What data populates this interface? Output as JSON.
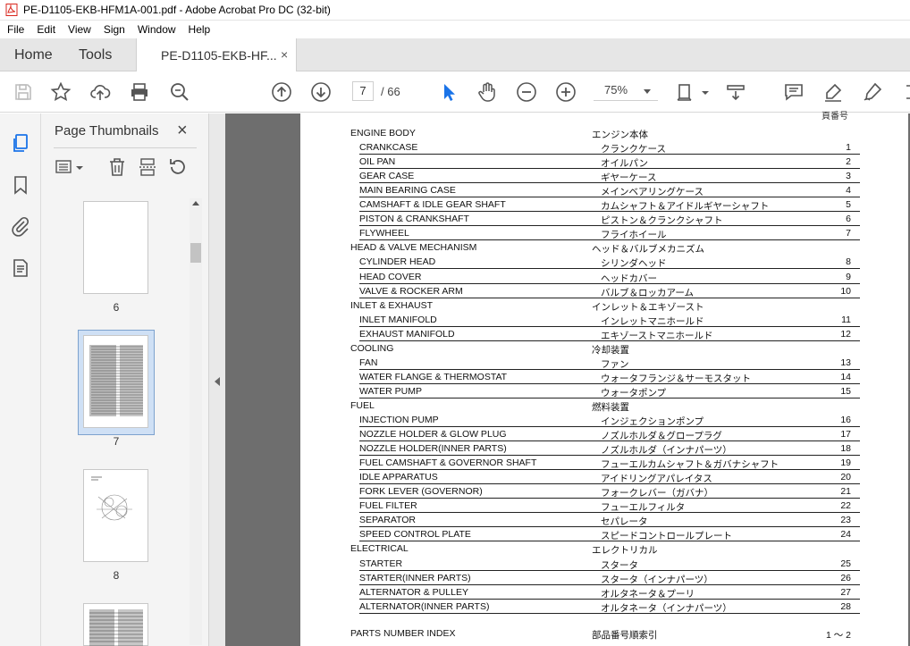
{
  "window": {
    "title": "PE-D1105-EKB-HFM1A-001.pdf - Adobe Acrobat Pro DC (32-bit)"
  },
  "menu": [
    "File",
    "Edit",
    "View",
    "Sign",
    "Window",
    "Help"
  ],
  "tabs": {
    "home": "Home",
    "tools": "Tools",
    "document": "PE-D1105-EKB-HF...",
    "close": "×"
  },
  "toolbar": {
    "page_current": "7",
    "page_total": "/ 66",
    "zoom": "75%"
  },
  "thumbnails": {
    "title": "Page Thumbnails",
    "close": "×",
    "pages": [
      "6",
      "7",
      "8"
    ]
  },
  "document": {
    "top_mark": "頁番号",
    "sections": [
      {
        "en": "ENGINE BODY",
        "jp": "エンジン本体",
        "items": [
          {
            "en": "CRANKCASE",
            "jp": "クランクケース",
            "page": "1"
          },
          {
            "en": "OIL PAN",
            "jp": "オイルパン",
            "page": "2"
          },
          {
            "en": "GEAR CASE",
            "jp": "ギヤーケース",
            "page": "3"
          },
          {
            "en": "MAIN BEARING CASE",
            "jp": "メインベアリングケース",
            "page": "4"
          },
          {
            "en": "CAMSHAFT & IDLE GEAR SHAFT",
            "jp": "カムシャフト＆アイドルギヤーシャフト",
            "page": "5"
          },
          {
            "en": "PISTON & CRANKSHAFT",
            "jp": "ピストン＆クランクシャフト",
            "page": "6"
          },
          {
            "en": "FLYWHEEL",
            "jp": "フライホイール",
            "page": "7"
          }
        ]
      },
      {
        "en": "HEAD & VALVE MECHANISM",
        "jp": "ヘッド＆バルブメカニズム",
        "items": [
          {
            "en": "CYLINDER HEAD",
            "jp": "シリンダヘッド",
            "page": "8"
          },
          {
            "en": "HEAD COVER",
            "jp": "ヘッドカバー",
            "page": "9"
          },
          {
            "en": "VALVE & ROCKER ARM",
            "jp": "バルブ＆ロッカアーム",
            "page": "10"
          }
        ]
      },
      {
        "en": "INLET & EXHAUST",
        "jp": "インレット＆エキゾースト",
        "items": [
          {
            "en": "INLET MANIFOLD",
            "jp": "インレットマニホールド",
            "page": "11"
          },
          {
            "en": "EXHAUST MANIFOLD",
            "jp": "エキゾーストマニホールド",
            "page": "12"
          }
        ]
      },
      {
        "en": "COOLING",
        "jp": "冷却装置",
        "items": [
          {
            "en": "FAN",
            "jp": "ファン",
            "page": "13"
          },
          {
            "en": "WATER FLANGE & THERMOSTAT",
            "jp": "ウォータフランジ＆サーモスタット",
            "page": "14"
          },
          {
            "en": "WATER PUMP",
            "jp": "ウォータポンプ",
            "page": "15"
          }
        ]
      },
      {
        "en": "FUEL",
        "jp": "燃料装置",
        "items": [
          {
            "en": "INJECTION PUMP",
            "jp": "インジェクションポンプ",
            "page": "16"
          },
          {
            "en": "NOZZLE HOLDER & GLOW PLUG",
            "jp": "ノズルホルダ＆グロープラグ",
            "page": "17"
          },
          {
            "en": "NOZZLE HOLDER(INNER PARTS)",
            "jp": "ノズルホルダ（インナパーツ）",
            "page": "18"
          },
          {
            "en": "FUEL CAMSHAFT & GOVERNOR SHAFT",
            "jp": "フューエルカムシャフト＆ガバナシャフト",
            "page": "19"
          },
          {
            "en": "IDLE APPARATUS",
            "jp": "アイドリングアパレイタス",
            "page": "20"
          },
          {
            "en": "FORK LEVER (GOVERNOR)",
            "jp": "フォークレバー（ガバナ）",
            "page": "21"
          },
          {
            "en": "FUEL FILTER",
            "jp": "フューエルフィルタ",
            "page": "22"
          },
          {
            "en": "SEPARATOR",
            "jp": "セパレータ",
            "page": "23"
          },
          {
            "en": "SPEED CONTROL PLATE",
            "jp": "スピードコントロールプレート",
            "page": "24"
          }
        ]
      },
      {
        "en": "ELECTRICAL",
        "jp": "エレクトリカル",
        "items": [
          {
            "en": "STARTER",
            "jp": "スタータ",
            "page": "25"
          },
          {
            "en": "STARTER(INNER PARTS)",
            "jp": "スタータ（インナパーツ）",
            "page": "26"
          },
          {
            "en": "ALTERNATOR & PULLEY",
            "jp": "オルタネータ＆プーリ",
            "page": "27"
          },
          {
            "en": "ALTERNATOR(INNER PARTS)",
            "jp": "オルタネータ（インナパーツ）",
            "page": "28"
          }
        ]
      }
    ],
    "index": {
      "en": "PARTS NUMBER INDEX",
      "jp": "部品番号順索引",
      "page": "1 ～ 2"
    }
  }
}
